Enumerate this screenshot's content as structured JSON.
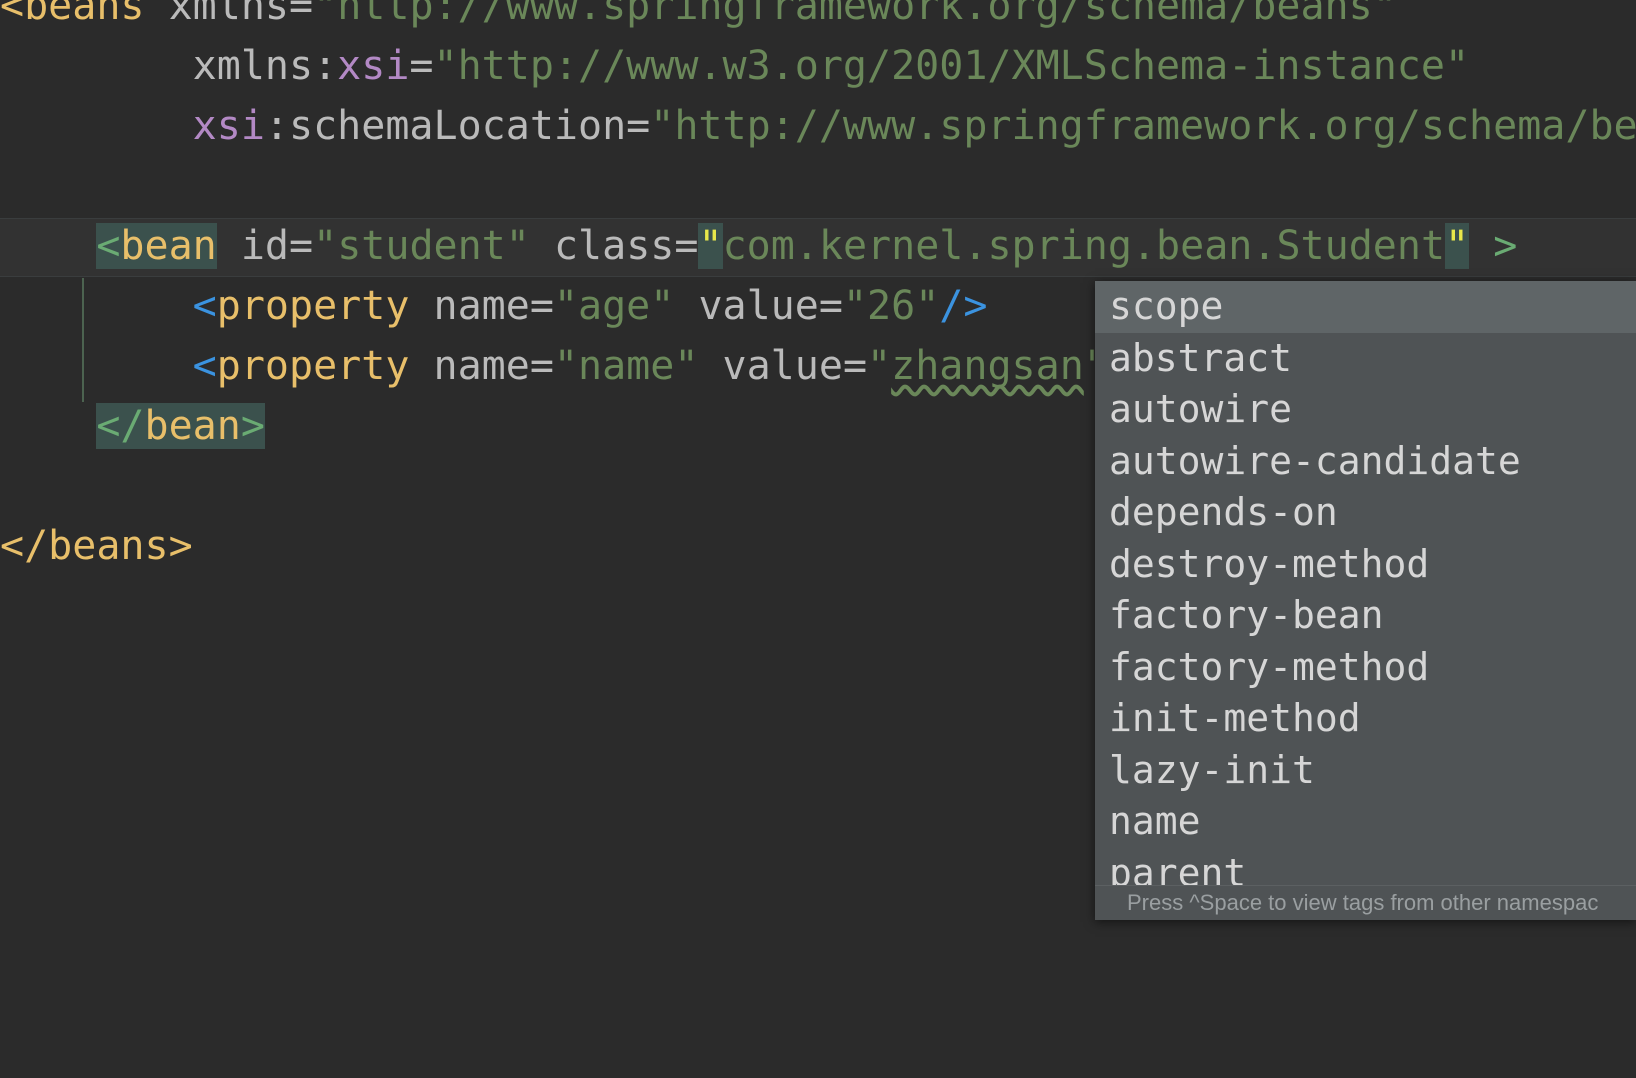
{
  "editor": {
    "background": "#2b2b2b",
    "caret_line_background": "#323232",
    "lines": [
      {
        "id": "line-beans-open",
        "segments": [
          {
            "text": "<beans",
            "kind": "tag"
          },
          {
            "text": " ",
            "kind": "plain"
          },
          {
            "text": "xmlns",
            "kind": "attr"
          },
          {
            "text": "=",
            "kind": "punct"
          },
          {
            "text": "\"http://www.springframework.org/schema/beans\"",
            "kind": "attrval"
          }
        ]
      },
      {
        "id": "line-xmlns-xsi",
        "segments": [
          {
            "text": "        ",
            "kind": "plain"
          },
          {
            "text": "xmlns",
            "kind": "attr"
          },
          {
            "text": ":",
            "kind": "punct"
          },
          {
            "text": "xsi",
            "kind": "ns"
          },
          {
            "text": "=",
            "kind": "punct"
          },
          {
            "text": "\"http://www.w3.org/2001/XMLSchema-instance\"",
            "kind": "attrval"
          }
        ]
      },
      {
        "id": "line-schema-location",
        "segments": [
          {
            "text": "        ",
            "kind": "plain"
          },
          {
            "text": "xsi",
            "kind": "ns"
          },
          {
            "text": ":",
            "kind": "punct"
          },
          {
            "text": "schemaLocation",
            "kind": "attr"
          },
          {
            "text": "=",
            "kind": "punct"
          },
          {
            "text": "\"http://www.springframework.org/schema/beans http:",
            "kind": "attrval"
          }
        ]
      },
      {
        "id": "line-blank-1",
        "segments": []
      },
      {
        "id": "line-bean-open",
        "caret": true,
        "segments": [
          {
            "text": "    ",
            "kind": "plain"
          },
          {
            "text": "<",
            "kind": "bracket-hl"
          },
          {
            "text": "bean",
            "kind": "tag-hl"
          },
          {
            "text": " ",
            "kind": "plain"
          },
          {
            "text": "id",
            "kind": "attr"
          },
          {
            "text": "=",
            "kind": "punct"
          },
          {
            "text": "\"student\"",
            "kind": "attrval"
          },
          {
            "text": " ",
            "kind": "plain"
          },
          {
            "text": "class",
            "kind": "attr"
          },
          {
            "text": "=",
            "kind": "punct"
          },
          {
            "text": "\"",
            "kind": "quote-hl"
          },
          {
            "text": "com.kernel.spring.bean.Student",
            "kind": "attrval"
          },
          {
            "text": "\"",
            "kind": "quote-hl"
          },
          {
            "text": " ",
            "kind": "plain"
          },
          {
            "text": ">",
            "kind": "bracket"
          }
        ]
      },
      {
        "id": "line-property-age",
        "segments": [
          {
            "text": "        ",
            "kind": "plain"
          },
          {
            "text": "<",
            "kind": "bracket-blue"
          },
          {
            "text": "property",
            "kind": "tag"
          },
          {
            "text": " ",
            "kind": "plain"
          },
          {
            "text": "name",
            "kind": "attr"
          },
          {
            "text": "=",
            "kind": "punct"
          },
          {
            "text": "\"age\"",
            "kind": "attrval"
          },
          {
            "text": " ",
            "kind": "plain"
          },
          {
            "text": "value",
            "kind": "attr"
          },
          {
            "text": "=",
            "kind": "punct"
          },
          {
            "text": "\"26\"",
            "kind": "attrval"
          },
          {
            "text": "/>",
            "kind": "bracket-blue"
          }
        ]
      },
      {
        "id": "line-property-name",
        "segments": [
          {
            "text": "        ",
            "kind": "plain"
          },
          {
            "text": "<",
            "kind": "bracket-blue"
          },
          {
            "text": "property",
            "kind": "tag"
          },
          {
            "text": " ",
            "kind": "plain"
          },
          {
            "text": "name",
            "kind": "attr"
          },
          {
            "text": "=",
            "kind": "punct"
          },
          {
            "text": "\"name\"",
            "kind": "attrval"
          },
          {
            "text": " ",
            "kind": "plain"
          },
          {
            "text": "value",
            "kind": "attr"
          },
          {
            "text": "=",
            "kind": "punct"
          },
          {
            "text": "\"",
            "kind": "attrval"
          },
          {
            "text": "zhangsan",
            "kind": "attrval-typo"
          },
          {
            "text": "\"",
            "kind": "attrval"
          },
          {
            "text": "/>",
            "kind": "bracket-blue"
          }
        ]
      },
      {
        "id": "line-bean-close",
        "segments": [
          {
            "text": "    ",
            "kind": "plain"
          },
          {
            "text": "</",
            "kind": "bracket-hl"
          },
          {
            "text": "bean",
            "kind": "tag-hl"
          },
          {
            "text": ">",
            "kind": "bracket-hl"
          }
        ]
      },
      {
        "id": "line-blank-2",
        "segments": []
      },
      {
        "id": "line-beans-close",
        "segments": [
          {
            "text": "</beans>",
            "kind": "tag"
          }
        ]
      }
    ]
  },
  "completion_popup": {
    "selected_item": "scope",
    "items": [
      "scope",
      "abstract",
      "autowire",
      "autowire-candidate",
      "depends-on",
      "destroy-method",
      "factory-bean",
      "factory-method",
      "init-method",
      "lazy-init",
      "name",
      "parent"
    ],
    "footer_hint": "Press ^Space to view tags from other namespac",
    "background": "#4f5355",
    "selected_background": "#5f6567",
    "text_color": "#d6d6d6"
  }
}
